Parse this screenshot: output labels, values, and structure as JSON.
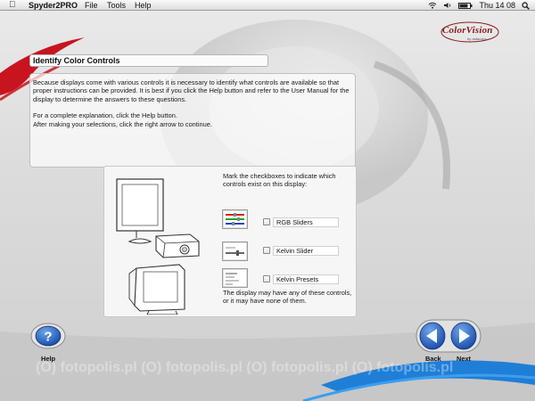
{
  "menubar": {
    "app_name": "Spyder2PRO",
    "menus": [
      "File",
      "Tools",
      "Help"
    ],
    "clock": "Thu 14 08"
  },
  "logo": {
    "brand": "ColorVision",
    "sub": "by datacolor"
  },
  "page_title": "Identify Color Controls",
  "instructions": {
    "paragraph1": "Because displays come with various controls it is necessary to identify what controls are available so that proper instructions can be provided. It is best if you click the Help button and refer to the User Manual for the display to determine the answers to these questions.",
    "line2": "For a complete explanation, click the Help button.",
    "line3": "After making your selections, click the right arrow to continue."
  },
  "controls": {
    "prompt": "Mark the checkboxes to indicate which controls exist on this display:",
    "options": [
      {
        "label": "RGB Sliders",
        "checked": false
      },
      {
        "label": "Kelvin Slider",
        "checked": false
      },
      {
        "label": "Kelvin Presets",
        "checked": false
      }
    ],
    "note": "The display may have any of these controls, or it may have none of them."
  },
  "buttons": {
    "help": "Help",
    "back": "Back",
    "next": "Next"
  },
  "colors": {
    "accent_red": "#c8141e",
    "accent_blue": "#1f7fd6",
    "nav_blue": "#1a4fb0"
  },
  "watermark": "fotopolis.pl"
}
